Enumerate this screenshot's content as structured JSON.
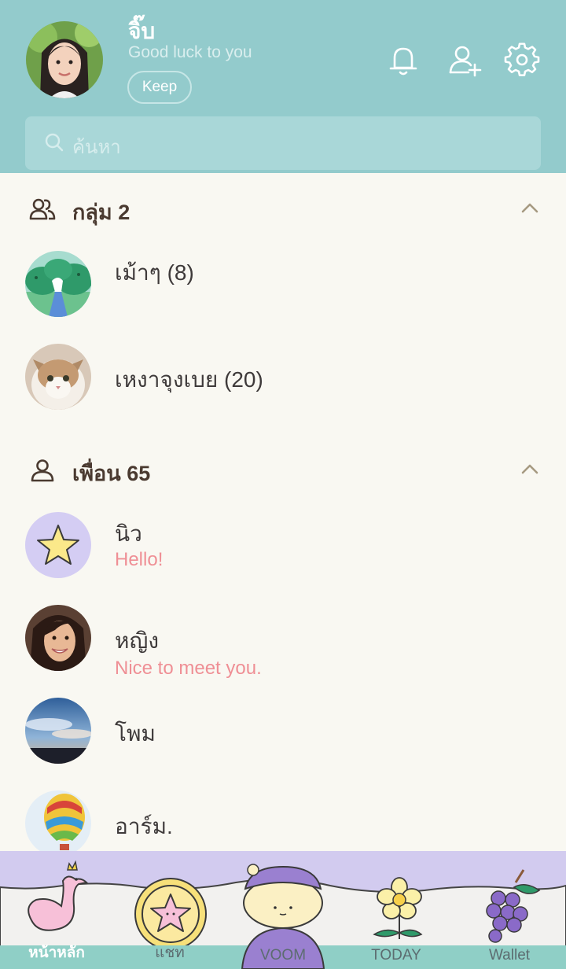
{
  "profile": {
    "name": "จิ๊บ",
    "status": "Good luck to you",
    "keep_label": "Keep"
  },
  "search": {
    "placeholder": "ค้นหา"
  },
  "groups": {
    "title": "กลุ่ม 2",
    "items": [
      {
        "name": "เม้าๆ (8)"
      },
      {
        "name": "เหงาจุงเบย (20)"
      }
    ]
  },
  "friends": {
    "title": "เพื่อน 65",
    "items": [
      {
        "name": "นิว",
        "message": "Hello!"
      },
      {
        "name": "หญิง",
        "message": "Nice to meet you."
      },
      {
        "name": "โพม",
        "message": ""
      },
      {
        "name": "อาร์ม.",
        "message": ""
      }
    ]
  },
  "tabs": [
    {
      "label": "หน้าหลัก",
      "icon": "swan-icon",
      "active": true
    },
    {
      "label": "แชท",
      "icon": "star-coin-icon",
      "active": false
    },
    {
      "label": "VOOM",
      "icon": "character-icon",
      "active": false
    },
    {
      "label": "TODAY",
      "icon": "flower-icon",
      "active": false
    },
    {
      "label": "Wallet",
      "icon": "grapes-icon",
      "active": false
    }
  ],
  "colors": {
    "header": "#93cbcc",
    "background": "#f9f8f2",
    "tabbar": "#d2cbef",
    "message": "#ef8f95",
    "text": "#3e3a3a"
  }
}
